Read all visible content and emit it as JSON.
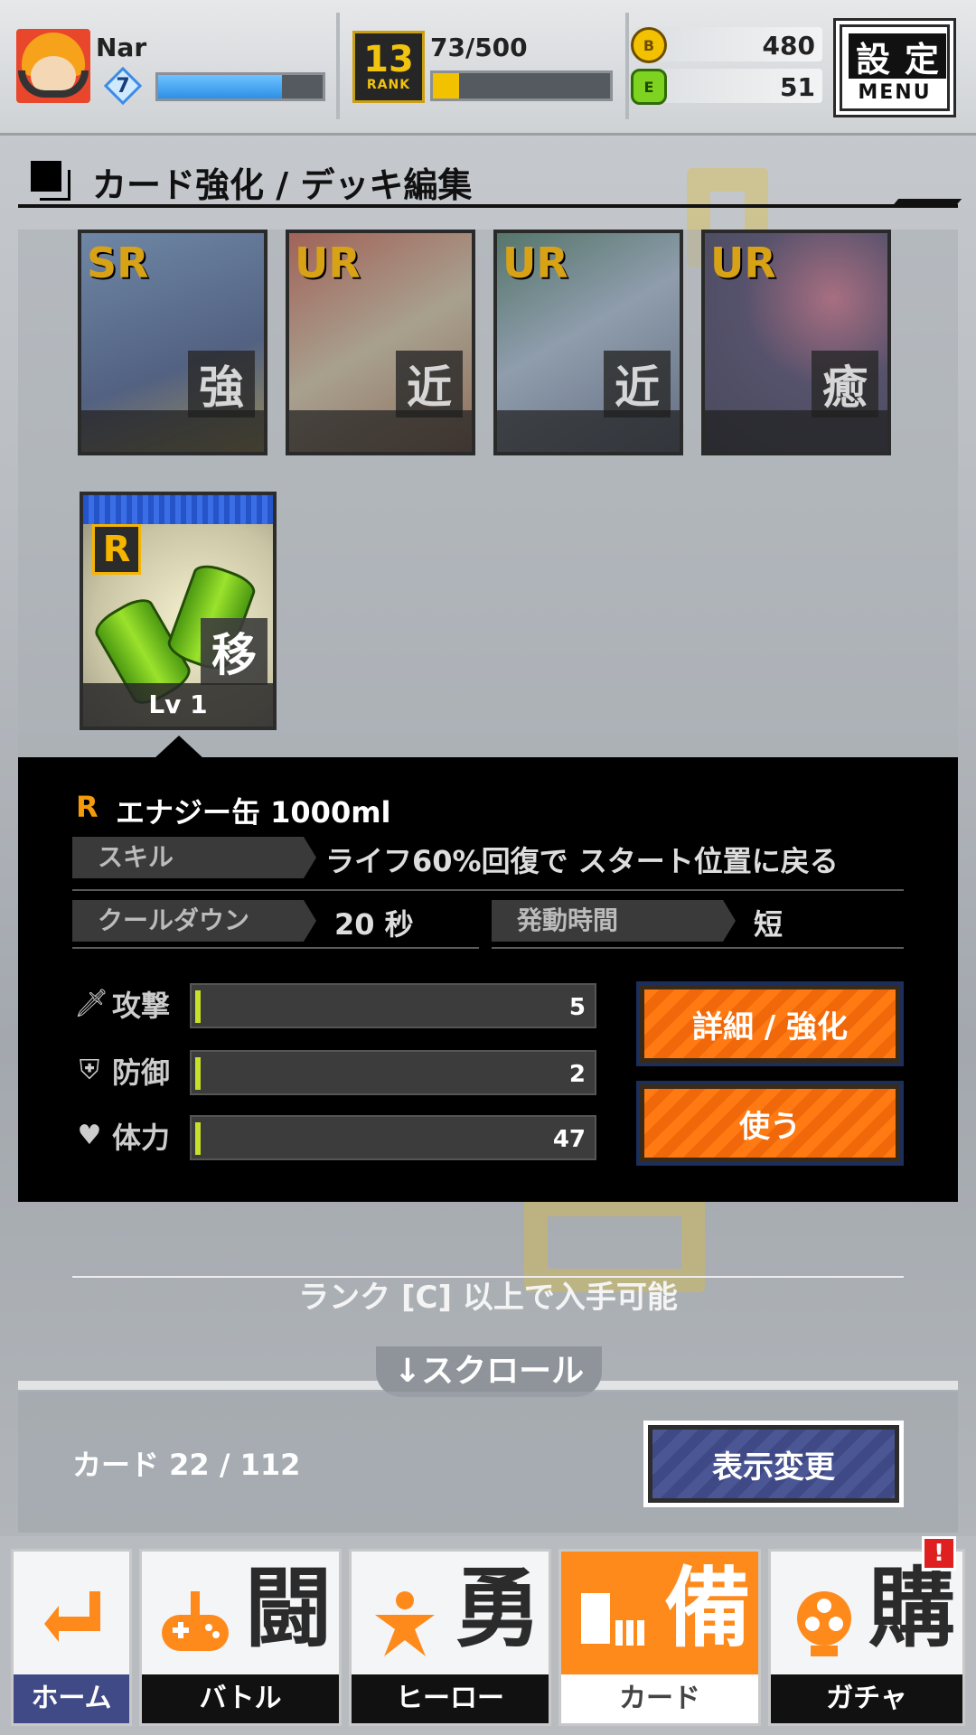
{
  "header": {
    "player_name": "Nar",
    "player_level": "7",
    "exp_fraction": 0.75,
    "rank_number": "13",
    "rank_label": "RANK",
    "rank_progress": "73/500",
    "rank_fraction": 0.146,
    "coins": "480",
    "energy": "51",
    "settings_k1": "設",
    "settings_k2": "定",
    "settings_menu": "MENU"
  },
  "section_title": "カード強化 / デッキ編集",
  "deck_cards": [
    {
      "rarity": "SR",
      "type": "強"
    },
    {
      "rarity": "UR",
      "type": "近"
    },
    {
      "rarity": "UR",
      "type": "近"
    },
    {
      "rarity": "UR",
      "type": "癒"
    }
  ],
  "selected_card": {
    "rarity": "R",
    "type": "移",
    "level": "Lv 1"
  },
  "detail": {
    "rarity": "R",
    "name": "エナジー缶 1000ml",
    "skill_label": "スキル",
    "skill_value": "ライフ60%回復で スタート位置に戻る",
    "cooldown_label": "クールダウン",
    "cooldown_value": "20 秒",
    "duration_label": "発動時間",
    "duration_value": "短",
    "stats": [
      {
        "icon": "sword-icon",
        "label": "攻撃",
        "value": "5"
      },
      {
        "icon": "shield-icon",
        "label": "防御",
        "value": "2"
      },
      {
        "icon": "heart-icon",
        "label": "体力",
        "value": "47"
      }
    ],
    "detail_button": "詳細 / 強化",
    "use_button": "使う"
  },
  "rank_note": "ランク [C] 以上で入手可能",
  "scroll_label": "↓スクロール",
  "card_count": "カード 22 / 112",
  "view_toggle_button": "表示変更",
  "nav": [
    {
      "glyph": "",
      "label": "ホーム",
      "icon": "back-arrow-icon"
    },
    {
      "glyph": "闘",
      "label": "バトル",
      "icon": "gamepad-icon"
    },
    {
      "glyph": "勇",
      "label": "ヒーロー",
      "icon": "hero-icon"
    },
    {
      "glyph": "備",
      "label": "カード",
      "icon": "cards-icon"
    },
    {
      "glyph": "購",
      "label": "ガチャ",
      "icon": "gacha-icon"
    }
  ],
  "nav_alert": "!",
  "colors": {
    "accent_orange": "#ff7a12",
    "nav_active": "#ff8a1c",
    "exp_blue": "#2d8fe6",
    "rank_yellow": "#f2c200",
    "stat_tick": "#c7e02a"
  }
}
